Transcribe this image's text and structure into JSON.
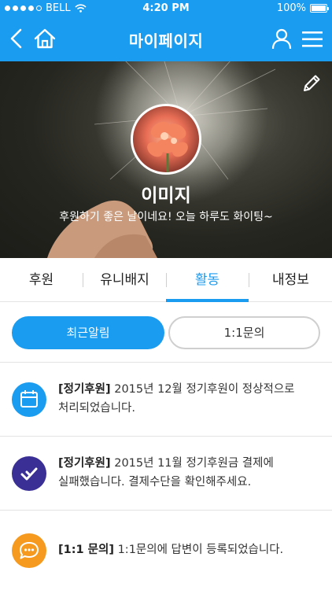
{
  "statusbar": {
    "carrier": "BELL",
    "time": "4:20 PM",
    "battery": "100%"
  },
  "header": {
    "title": "마이페이지"
  },
  "profile": {
    "name": "이미지",
    "message": "후원하기 좋은 날이네요! 오늘 하루도 화이팅~"
  },
  "tabs": [
    {
      "label": "후원",
      "active": false
    },
    {
      "label": "유니배지",
      "active": false
    },
    {
      "label": "활동",
      "active": true
    },
    {
      "label": "내정보",
      "active": false
    }
  ],
  "segments": {
    "active_label": "최근알림",
    "other_label": "1:1문의"
  },
  "notifications": [
    {
      "icon": "calendar-icon",
      "color": "#1a9cf0",
      "tag": "[정기후원]",
      "line1": " 2015년 12월 정기후원이 정상적으로",
      "line2": "처리되었습니다."
    },
    {
      "icon": "check-icon",
      "color": "#3a2f94",
      "tag": "[정기후원]",
      "line1": " 2015년 11월 정기후원금 결제에",
      "line2": "실패했습니다. 결제수단을 확인해주세요."
    },
    {
      "icon": "chat-icon",
      "color": "#f59a1e",
      "tag": "[1:1 문의]",
      "line1": " 1:1문의에 답변이 등록되었습니다.",
      "line2": ""
    }
  ],
  "colors": {
    "primary": "#1a9cf0",
    "purple": "#3a2f94",
    "orange": "#f59a1e"
  }
}
